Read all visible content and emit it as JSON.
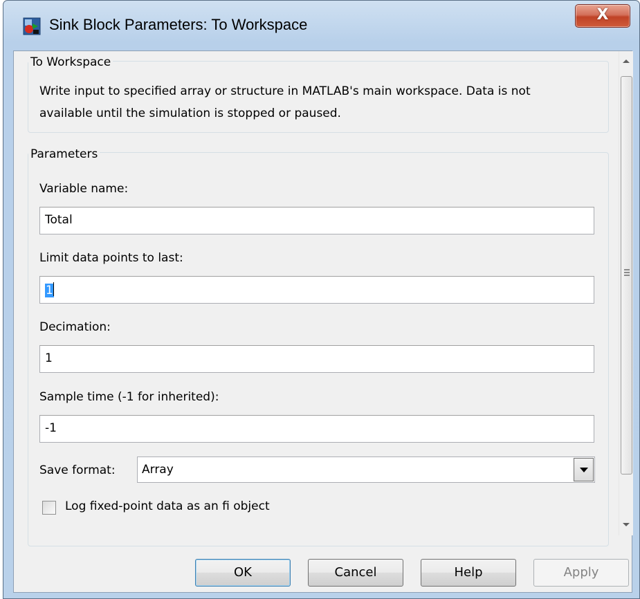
{
  "window": {
    "title": "Sink Block Parameters: To Workspace",
    "close_label": "X"
  },
  "block": {
    "name": "To Workspace",
    "description_lines": [
      "Write input to specified array or structure in MATLAB's main workspace. Data is not",
      "available until the simulation is stopped or paused."
    ]
  },
  "parameters": {
    "heading": "Parameters",
    "variable_name": {
      "label": "Variable name:",
      "value": "Total"
    },
    "limit_points": {
      "label": "Limit data points to last:",
      "value": "1"
    },
    "decimation": {
      "label": "Decimation:",
      "value": "1"
    },
    "sample_time": {
      "label": "Sample time (-1 for inherited):",
      "value": "-1"
    },
    "save_format": {
      "label": "Save format:",
      "value": "Array"
    },
    "log_fixed_point": {
      "label": "Log fixed-point data as an fi object",
      "checked": false
    }
  },
  "buttons": {
    "ok": "OK",
    "cancel": "Cancel",
    "help": "Help",
    "apply": "Apply"
  },
  "colors": {
    "frame": "#b9d1ea",
    "client": "#f0f0f0",
    "selection": "#3399ff",
    "close": "#c04326"
  },
  "scrollbar": {
    "position_fraction": 0.0
  }
}
